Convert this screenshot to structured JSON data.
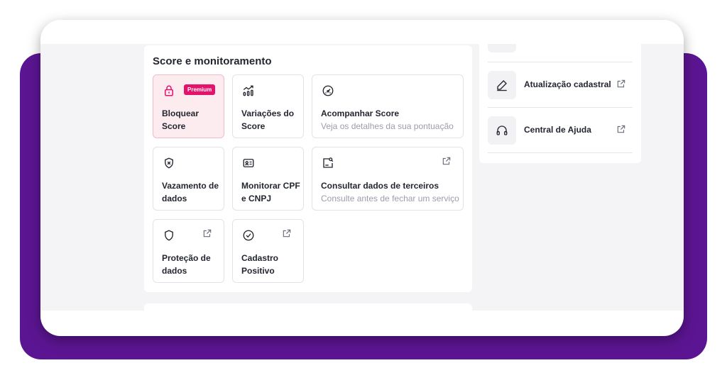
{
  "section": {
    "title": "Score e monitoramento"
  },
  "tiles": [
    {
      "label": "Bloquear\nScore",
      "badge": "Premium",
      "icon": "lock-icon"
    },
    {
      "label": "Variações do\nScore",
      "icon": "chart-trend-icon"
    },
    {
      "label": "Acompanhar Score",
      "description": "Veja os detalhes da sua pontuação",
      "icon": "gauge-icon"
    },
    {
      "label": "Vazamento de\ndados",
      "icon": "shield-x-icon"
    },
    {
      "label": "Monitorar CPF\ne CNPJ",
      "icon": "id-card-icon"
    },
    {
      "label": "Consultar dados de terceiros",
      "description": "Consulte antes de fechar um serviço",
      "icon": "document-search-icon",
      "external": true
    },
    {
      "label": "Proteção de\ndados",
      "icon": "shield-icon",
      "external": true
    },
    {
      "label": "Cadastro\nPositivo",
      "icon": "check-circle-icon",
      "external": true
    }
  ],
  "sidebar": {
    "items": [
      {
        "label": "Atualização cadastral",
        "icon": "pencil-icon",
        "external": true
      },
      {
        "label": "Central de Ajuda",
        "icon": "headphones-icon",
        "external": true
      }
    ]
  },
  "colors": {
    "brand_purple": "#5c1592",
    "premium_badge": "#e5126b",
    "premium_tile_bg": "#fdecef"
  }
}
